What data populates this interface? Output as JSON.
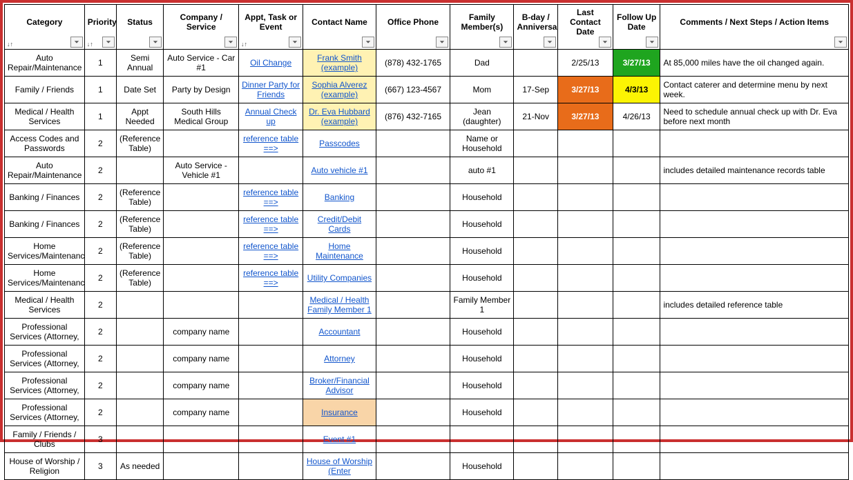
{
  "columns": [
    {
      "label": "Category",
      "hasSort": true,
      "hasFilter": true
    },
    {
      "label": "Priority",
      "hasSort": true,
      "hasFilter": true
    },
    {
      "label": "Status",
      "hasSort": false,
      "hasFilter": true
    },
    {
      "label": "Company / Service",
      "hasSort": false,
      "hasFilter": true
    },
    {
      "label": "Appt, Task or Event",
      "hasSort": true,
      "hasFilter": true
    },
    {
      "label": "Contact Name",
      "hasSort": false,
      "hasFilter": true
    },
    {
      "label": "Office Phone",
      "hasSort": false,
      "hasFilter": true
    },
    {
      "label": "Family Member(s)",
      "hasSort": false,
      "hasFilter": true
    },
    {
      "label": "B-day / Anniversary",
      "hasSort": false,
      "hasFilter": true
    },
    {
      "label": "Last Contact Date",
      "hasSort": false,
      "hasFilter": true
    },
    {
      "label": "Follow Up Date",
      "hasSort": false,
      "hasFilter": true
    },
    {
      "label": "Comments / Next Steps / Action Items",
      "hasSort": false,
      "hasFilter": true
    }
  ],
  "rows": [
    {
      "cells": [
        {
          "text": "Auto Repair/Maintenance"
        },
        {
          "text": "1"
        },
        {
          "text": "Semi Annual"
        },
        {
          "text": "Auto Service - Car #1"
        },
        {
          "text": "Oil Change",
          "link": true
        },
        {
          "text": "Frank Smith (example)",
          "link": true,
          "hl": "hl-yellow"
        },
        {
          "text": "(878) 432-1765"
        },
        {
          "text": "Dad"
        },
        {
          "text": ""
        },
        {
          "text": "2/25/13"
        },
        {
          "text": "3/27/13",
          "hl": "hl-green"
        },
        {
          "text": "At 85,000 miles have the oil changed again.",
          "align": "left"
        }
      ]
    },
    {
      "cells": [
        {
          "text": "Family / Friends"
        },
        {
          "text": "1"
        },
        {
          "text": "Date Set"
        },
        {
          "text": "Party by Design"
        },
        {
          "text": "Dinner Party for Friends",
          "link": true
        },
        {
          "text": "Sophia Alverez (example)",
          "link": true,
          "hl": "hl-yellow"
        },
        {
          "text": "(667) 123-4567"
        },
        {
          "text": "Mom"
        },
        {
          "text": "17-Sep"
        },
        {
          "text": "3/27/13",
          "hl": "hl-orange"
        },
        {
          "text": "4/3/13",
          "hl": "hl-bright-yellow"
        },
        {
          "text": "Contact caterer and determine menu by next week.",
          "align": "left"
        }
      ]
    },
    {
      "cells": [
        {
          "text": "Medical / Health Services"
        },
        {
          "text": "1"
        },
        {
          "text": "Appt Needed"
        },
        {
          "text": "South Hills Medical Group"
        },
        {
          "text": "Annual Check up",
          "link": true
        },
        {
          "text": "Dr. Eva Hubbard (example)",
          "link": true,
          "hl": "hl-yellow"
        },
        {
          "text": "(876) 432-7165"
        },
        {
          "text": "Jean (daughter)"
        },
        {
          "text": "21-Nov"
        },
        {
          "text": "3/27/13",
          "hl": "hl-orange"
        },
        {
          "text": "4/26/13"
        },
        {
          "text": "Need to schedule annual check up with Dr. Eva before next month",
          "align": "left"
        }
      ]
    },
    {
      "cells": [
        {
          "text": "Access Codes and Passwords"
        },
        {
          "text": "2"
        },
        {
          "text": "(Reference Table)"
        },
        {
          "text": ""
        },
        {
          "text": "reference table ==>",
          "link": true
        },
        {
          "text": "Passcodes",
          "link": true
        },
        {
          "text": ""
        },
        {
          "text": "Name or Household"
        },
        {
          "text": ""
        },
        {
          "text": ""
        },
        {
          "text": ""
        },
        {
          "text": "",
          "align": "left"
        }
      ]
    },
    {
      "cells": [
        {
          "text": "Auto Repair/Maintenance"
        },
        {
          "text": "2"
        },
        {
          "text": ""
        },
        {
          "text": "Auto Service - Vehicle #1"
        },
        {
          "text": ""
        },
        {
          "text": "Auto vehicle #1",
          "link": true
        },
        {
          "text": ""
        },
        {
          "text": "auto #1"
        },
        {
          "text": ""
        },
        {
          "text": ""
        },
        {
          "text": ""
        },
        {
          "text": "includes detailed maintenance records table",
          "align": "left"
        }
      ]
    },
    {
      "cells": [
        {
          "text": "Banking / Finances"
        },
        {
          "text": "2"
        },
        {
          "text": "(Reference Table)"
        },
        {
          "text": ""
        },
        {
          "text": "reference table ==>",
          "link": true
        },
        {
          "text": "Banking",
          "link": true
        },
        {
          "text": ""
        },
        {
          "text": "Household"
        },
        {
          "text": ""
        },
        {
          "text": ""
        },
        {
          "text": ""
        },
        {
          "text": "",
          "align": "left"
        }
      ]
    },
    {
      "cells": [
        {
          "text": "Banking / Finances"
        },
        {
          "text": "2"
        },
        {
          "text": "(Reference Table)"
        },
        {
          "text": ""
        },
        {
          "text": "reference table ==>",
          "link": true
        },
        {
          "text": "Credit/Debit Cards",
          "link": true
        },
        {
          "text": ""
        },
        {
          "text": "Household"
        },
        {
          "text": ""
        },
        {
          "text": ""
        },
        {
          "text": ""
        },
        {
          "text": "",
          "align": "left"
        }
      ]
    },
    {
      "cells": [
        {
          "text": "Home Services/Maintenance"
        },
        {
          "text": "2"
        },
        {
          "text": "(Reference Table)"
        },
        {
          "text": ""
        },
        {
          "text": "reference table ==>",
          "link": true
        },
        {
          "text": "Home Maintenance",
          "link": true
        },
        {
          "text": ""
        },
        {
          "text": "Household"
        },
        {
          "text": ""
        },
        {
          "text": ""
        },
        {
          "text": ""
        },
        {
          "text": "",
          "align": "left"
        }
      ]
    },
    {
      "cells": [
        {
          "text": "Home Services/Maintenance"
        },
        {
          "text": "2"
        },
        {
          "text": "(Reference Table)"
        },
        {
          "text": ""
        },
        {
          "text": "reference table ==>",
          "link": true
        },
        {
          "text": "Utility Companies",
          "link": true
        },
        {
          "text": ""
        },
        {
          "text": "Household"
        },
        {
          "text": ""
        },
        {
          "text": ""
        },
        {
          "text": ""
        },
        {
          "text": "",
          "align": "left"
        }
      ]
    },
    {
      "cells": [
        {
          "text": "Medical / Health Services"
        },
        {
          "text": "2"
        },
        {
          "text": ""
        },
        {
          "text": ""
        },
        {
          "text": ""
        },
        {
          "text": "Medical / Health Family Member 1",
          "link": true
        },
        {
          "text": ""
        },
        {
          "text": "Family Member 1"
        },
        {
          "text": ""
        },
        {
          "text": ""
        },
        {
          "text": ""
        },
        {
          "text": "includes detailed reference table",
          "align": "left"
        }
      ]
    },
    {
      "cells": [
        {
          "text": "Professional Services (Attorney,"
        },
        {
          "text": "2"
        },
        {
          "text": ""
        },
        {
          "text": "company name"
        },
        {
          "text": ""
        },
        {
          "text": "Accountant",
          "link": true
        },
        {
          "text": ""
        },
        {
          "text": "Household"
        },
        {
          "text": ""
        },
        {
          "text": ""
        },
        {
          "text": ""
        },
        {
          "text": "",
          "align": "left"
        }
      ]
    },
    {
      "cells": [
        {
          "text": "Professional Services (Attorney,"
        },
        {
          "text": "2"
        },
        {
          "text": ""
        },
        {
          "text": "company name"
        },
        {
          "text": ""
        },
        {
          "text": "Attorney",
          "link": true
        },
        {
          "text": ""
        },
        {
          "text": "Household"
        },
        {
          "text": ""
        },
        {
          "text": ""
        },
        {
          "text": ""
        },
        {
          "text": "",
          "align": "left"
        }
      ]
    },
    {
      "cells": [
        {
          "text": "Professional Services (Attorney,"
        },
        {
          "text": "2"
        },
        {
          "text": ""
        },
        {
          "text": "company name"
        },
        {
          "text": ""
        },
        {
          "text": "Broker/Financial Advisor",
          "link": true
        },
        {
          "text": ""
        },
        {
          "text": "Household"
        },
        {
          "text": ""
        },
        {
          "text": ""
        },
        {
          "text": ""
        },
        {
          "text": "",
          "align": "left"
        }
      ]
    },
    {
      "cells": [
        {
          "text": "Professional Services (Attorney,"
        },
        {
          "text": "2"
        },
        {
          "text": ""
        },
        {
          "text": "company name"
        },
        {
          "text": ""
        },
        {
          "text": "Insurance",
          "link": true,
          "hl": "hl-peach"
        },
        {
          "text": ""
        },
        {
          "text": "Household"
        },
        {
          "text": ""
        },
        {
          "text": ""
        },
        {
          "text": ""
        },
        {
          "text": "",
          "align": "left"
        }
      ]
    },
    {
      "cells": [
        {
          "text": "Family / Friends / Clubs"
        },
        {
          "text": "3"
        },
        {
          "text": ""
        },
        {
          "text": ""
        },
        {
          "text": ""
        },
        {
          "text": "Event #1",
          "link": true
        },
        {
          "text": ""
        },
        {
          "text": ""
        },
        {
          "text": ""
        },
        {
          "text": ""
        },
        {
          "text": ""
        },
        {
          "text": "",
          "align": "left"
        }
      ]
    },
    {
      "cells": [
        {
          "text": "House of Worship / Religion"
        },
        {
          "text": "3"
        },
        {
          "text": "As needed"
        },
        {
          "text": ""
        },
        {
          "text": ""
        },
        {
          "text": "House of Worship (Enter",
          "link": true
        },
        {
          "text": ""
        },
        {
          "text": "Household"
        },
        {
          "text": ""
        },
        {
          "text": ""
        },
        {
          "text": ""
        },
        {
          "text": "",
          "align": "left"
        }
      ]
    }
  ]
}
